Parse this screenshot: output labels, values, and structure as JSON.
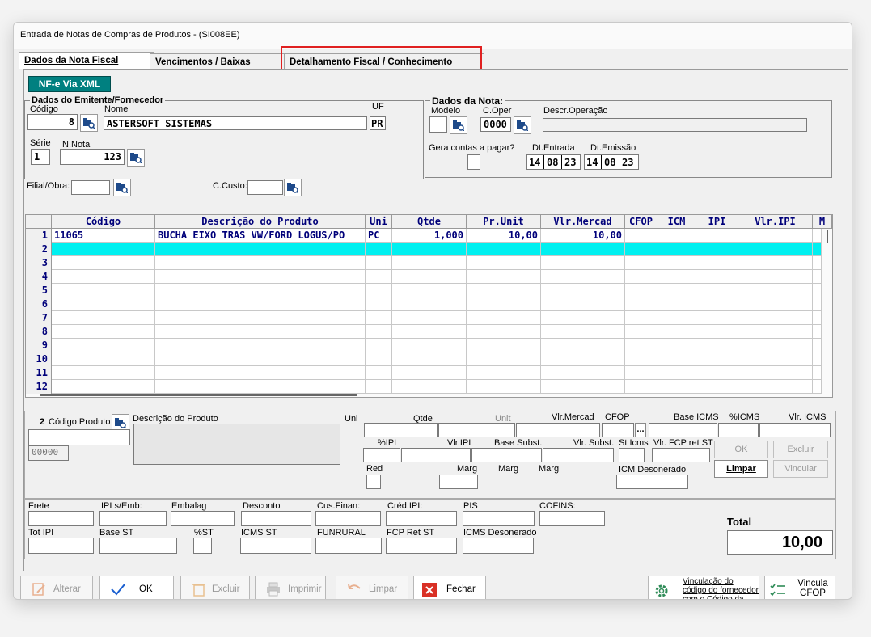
{
  "window": {
    "title": "Entrada de Notas de Compras de Produtos  - (SI008EE)"
  },
  "tabs": [
    {
      "label": "Dados da Nota Fiscal"
    },
    {
      "label": "Vencimentos / Baixas"
    },
    {
      "label": "Detalhamento Fiscal / Conhecimento"
    }
  ],
  "nfe_button": "NF-e Via XML",
  "emitente": {
    "group_label": "Dados do Emitente/Fornecedor",
    "codigo_label": "Código",
    "codigo": "8",
    "nome_label": "Nome",
    "nome": "ASTERSOFT SISTEMAS",
    "uf_label": "UF",
    "uf": "PR",
    "serie_label": "Série",
    "serie": "1",
    "nnota_label": "N.Nota",
    "nnota": "123"
  },
  "nota": {
    "group_label": "Dados da Nota:",
    "modelo_label": "Modelo",
    "modelo": "",
    "coper_label": "C.Oper",
    "coper": "0000",
    "descr_label": "Descr.Operação",
    "descr": "",
    "gera_label": "Gera contas a pagar?",
    "dtentrada_label": "Dt.Entrada",
    "dtentrada": [
      "14",
      "08",
      "23"
    ],
    "dtemissao_label": "Dt.Emissão",
    "dtemissao": [
      "14",
      "08",
      "23"
    ]
  },
  "filial_label": "Filial/Obra:",
  "ccusto_label": "C.Custo:",
  "grid": {
    "columns": [
      "Código",
      "Descrição do Produto",
      "Uni",
      "Qtde",
      "Pr.Unit",
      "Vlr.Mercad",
      "CFOP",
      "ICM",
      "IPI",
      "Vlr.IPI",
      "M"
    ],
    "rows": [
      {
        "n": "1",
        "codigo": "11065",
        "descricao": "BUCHA EIXO TRAS VW/FORD LOGUS/PO",
        "uni": "PC",
        "qtde": "1,000",
        "prunit": "10,00",
        "vlrmercad": "10,00"
      },
      {
        "n": "2"
      },
      {
        "n": "3"
      },
      {
        "n": "4"
      },
      {
        "n": "5"
      },
      {
        "n": "6"
      },
      {
        "n": "7"
      },
      {
        "n": "8"
      },
      {
        "n": "9"
      },
      {
        "n": "10"
      },
      {
        "n": "11"
      },
      {
        "n": "12"
      }
    ]
  },
  "item": {
    "row_number": "2",
    "codigo_label": "Código Produto",
    "descricao_label": "Descrição do Produto",
    "uni_label": "Uni",
    "code_box": "00000",
    "qtde_label": "Qtde",
    "unit_label": "Unit",
    "vlrmercad_label": "Vlr.Mercad",
    "cfop_label": "CFOP",
    "cfop_btn": "...",
    "baseicms_label": "Base ICMS",
    "picms_label": "%ICMS",
    "vlricms_label": "Vlr. ICMS",
    "pipi_label": "%IPI",
    "vlripi_label": "Vlr.IPI",
    "basesubst_label": "Base Subst.",
    "vlrsubst_label": "Vlr. Subst.",
    "sticms_label": "St Icms",
    "vlrfcp_label": "Vlr. FCP ret ST",
    "red_label": "Red",
    "marg1_label": "Marg",
    "marg2_label": "Marg",
    "marg3_label": "Marg",
    "icmsdeson_label": "ICM Desonerado",
    "ok_btn": "OK",
    "excluir_btn": "Excluir",
    "limpar_btn": "Limpar",
    "vincular_btn": "Vincular"
  },
  "totais": {
    "frete": "Frete",
    "ipiemb": "IPI s/Emb:",
    "embalag": "Embalag",
    "desconto": "Desconto",
    "cusfinan": "Cus.Finan:",
    "credipi": "Créd.IPI:",
    "pis": "PIS",
    "cofins": "COFINS:",
    "totipi": "Tot IPI",
    "basest": "Base ST",
    "pst": "%ST",
    "icmsst": "ICMS ST",
    "funrural": "FUNRURAL",
    "fcpretst": "FCP Ret ST",
    "icmsdeson": "ICMS Desonerado",
    "total_label": "Total",
    "total_value": "10,00"
  },
  "toolbar": {
    "alterar": "Alterar",
    "ok": "OK",
    "excluir": "Excluir",
    "imprimir": "Imprimir",
    "limpar": "Limpar",
    "fechar": "Fechar",
    "vinculacao": "Vinculação do código do fornecedor com o Código da Empresa",
    "vincula_cfop": "Vincula CFOP"
  },
  "colors": {
    "accent_teal": "#008080",
    "selected_row": "#00f0f0",
    "grid_text": "#00007a",
    "highlight_red": "#e02020"
  }
}
